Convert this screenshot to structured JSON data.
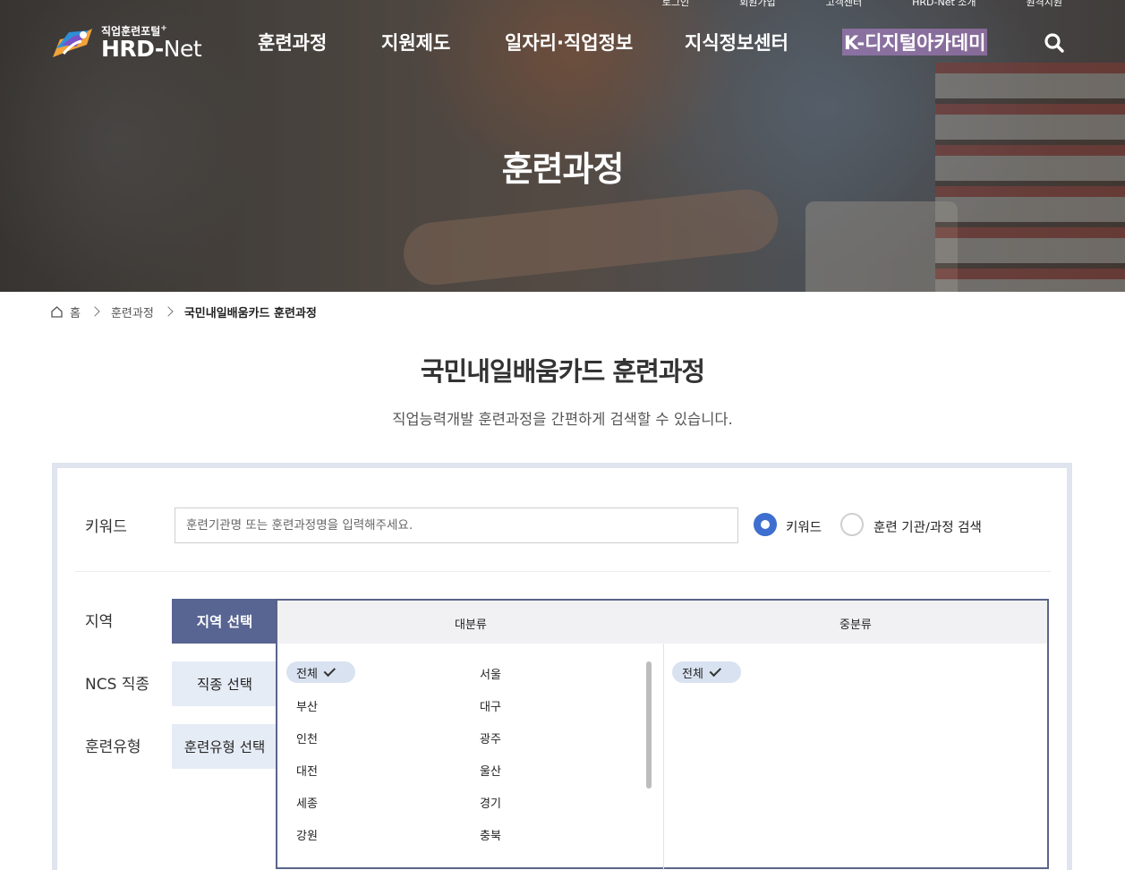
{
  "header": {
    "util_links": [
      "로그인",
      "회원가입",
      "고객센터",
      "HRD-Net 소개",
      "원격지원"
    ],
    "logo": {
      "subtitle": "직업훈련포털",
      "title_bold": "HRD",
      "title_rest": "Net"
    },
    "nav": [
      "훈련과정",
      "지원제도",
      "일자리·직업정보",
      "지식정보센터",
      "K-디지털아카데미"
    ],
    "search_icon": "search-icon"
  },
  "hero": {
    "title": "훈련과정"
  },
  "breadcrumb": {
    "home": "홈",
    "section": "훈련과정",
    "current": "국민내일배움카드 훈련과정"
  },
  "page": {
    "title": "국민내일배움카드 훈련과정",
    "description": "직업능력개발 훈련과정을 간편하게 검색할 수 있습니다."
  },
  "search": {
    "keyword_label": "키워드",
    "keyword_placeholder": "훈련기관명 또는 훈련과정명을 입력해주세요.",
    "radio_keyword": "키워드",
    "radio_institution": "훈련 기관/과정 검색",
    "radio_selected": "키워드",
    "region_label": "지역",
    "ncs_label": "NCS 직종",
    "type_label": "훈련유형",
    "btn_region": "지역 선택",
    "btn_ncs": "직종 선택",
    "btn_type": "훈련유형 선택",
    "col_major": "대분류",
    "col_minor": "중분류",
    "major_selected": "전체",
    "major_options": [
      "서울",
      "부산",
      "대구",
      "인천",
      "광주",
      "대전",
      "울산",
      "세종",
      "경기",
      "강원",
      "충북"
    ],
    "minor_selected": "전체"
  },
  "colors": {
    "accent": "#586491",
    "radio": "#3e6fd0",
    "chip": "#d9e2f0",
    "panel_border": "#dfe4ee"
  }
}
